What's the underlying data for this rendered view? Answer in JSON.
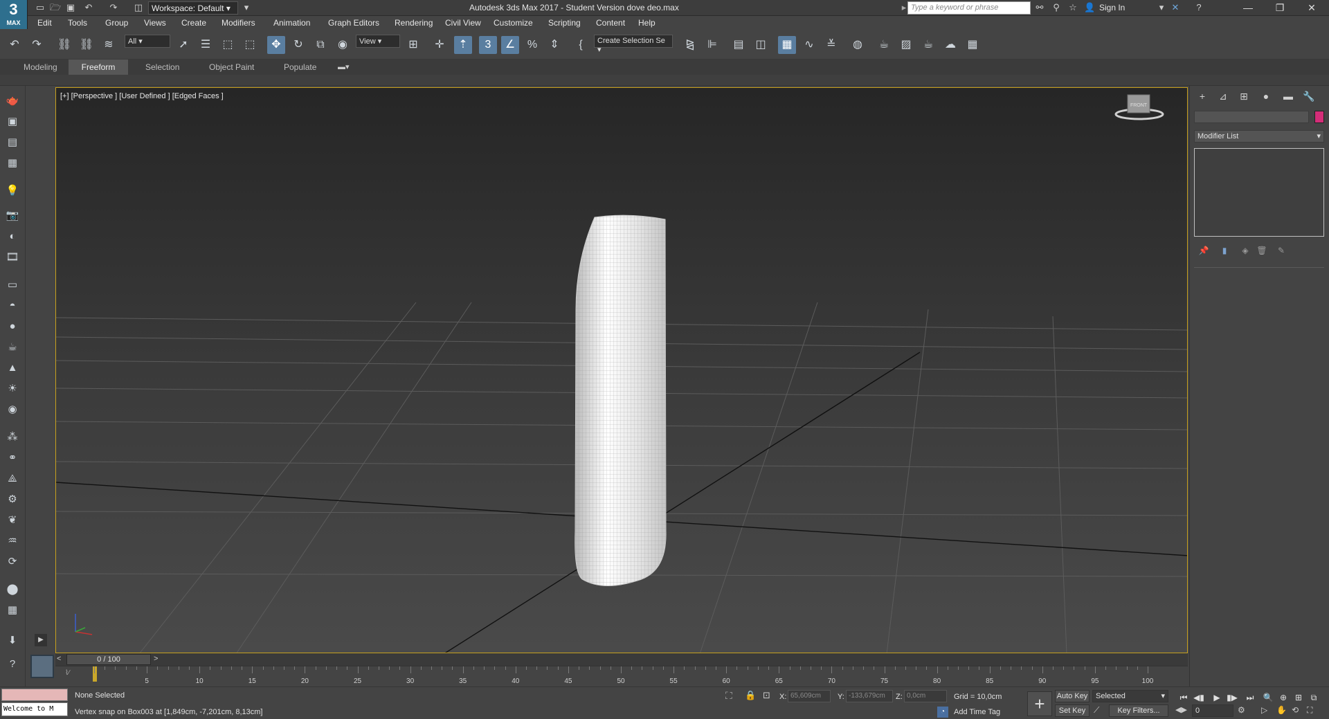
{
  "app": {
    "logo_big": "3",
    "logo_small": "MAX",
    "title": "Autodesk 3ds Max 2017 - Student Version    dove deo.max",
    "workspace_label": "Workspace: Default",
    "search_placeholder": "Type a keyword or phrase",
    "signin_label": "Sign In"
  },
  "menu": [
    "Edit",
    "Tools",
    "Group",
    "Views",
    "Create",
    "Modifiers",
    "Animation",
    "Graph Editors",
    "Rendering",
    "Civil View",
    "Customize",
    "Scripting",
    "Content",
    "Help"
  ],
  "toolbar": {
    "filter_value": "All",
    "ref_coord_value": "View",
    "selection_set_value": "Create Selection Se"
  },
  "ribbon": {
    "tabs": [
      "Modeling",
      "Freeform",
      "Selection",
      "Object Paint",
      "Populate"
    ],
    "active_tab": "Freeform"
  },
  "viewport": {
    "label": "[+] [Perspective ] [User Defined ] [Edged Faces ]",
    "viewcube_label": "FRONT",
    "active_border_color": "#c8a11e"
  },
  "command_panel": {
    "modifier_list_label": "Modifier List",
    "object_color": "#d42d78"
  },
  "timeline": {
    "slider_label": "0 / 100",
    "ticks": [
      "5",
      "10",
      "15",
      "20",
      "25",
      "30",
      "35",
      "40",
      "45",
      "50",
      "55",
      "60",
      "65",
      "70",
      "75",
      "80",
      "85",
      "90",
      "95",
      "100"
    ],
    "playhead_color": "#c9a72a"
  },
  "status": {
    "welcome_text": "Welcome to M",
    "selection_status": "None Selected",
    "prompt": "Vertex snap on Box003 at [1,849cm, -7,201cm, 8,13cm]",
    "x_label": "X:",
    "x_value": "65,609cm",
    "y_label": "Y:",
    "y_value": "-133,679cm",
    "z_label": "Z:",
    "z_value": "0,0cm",
    "grid": "Grid = 10,0cm",
    "add_time_tag": "Add Time Tag",
    "auto_key": "Auto Key",
    "set_key": "Set Key",
    "key_mode_value": "Selected",
    "key_filters": "Key Filters...",
    "frame_value": "0"
  }
}
